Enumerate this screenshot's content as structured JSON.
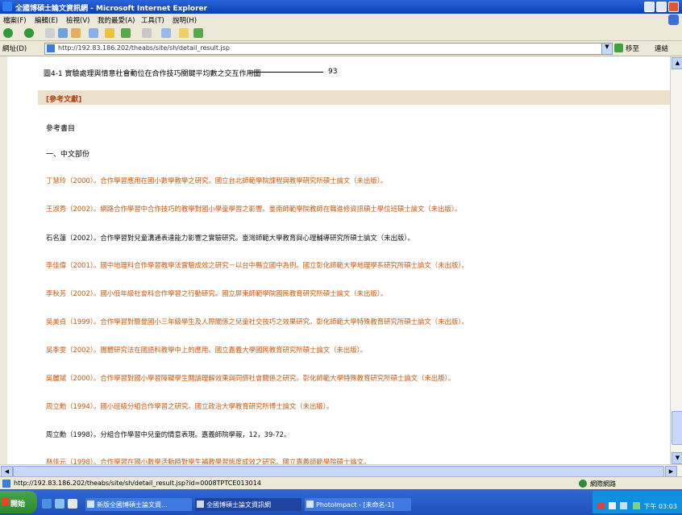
{
  "window": {
    "title": "全國博碩士論文資訊網 - Microsoft Internet Explorer"
  },
  "menu": [
    "檔案(F)",
    "編輯(E)",
    "檢視(V)",
    "我的最愛(A)",
    "工具(T)",
    "說明(H)"
  ],
  "address": {
    "label": "網址(D)",
    "url": "http://192.83.186.202/theabs/site/sh/detail_result.jsp",
    "go_label": "移至",
    "links_label": "連結"
  },
  "page": {
    "figure_caption": "圖4-1 實驗處理與情意社會動位在合作技巧關鍵平均數之交互作用圖",
    "figure_page": "93",
    "references_tab": "[參考文獻]",
    "heading": "參考書目",
    "subheading": "一、中文部份",
    "references": [
      {
        "text": "丁慧玲（2000）。合作學習應用在國小數學教學之研究。國立台北師範學院課程與教學研究所碩士論文（未出版）。",
        "color": "orange"
      },
      {
        "text": "王淑秀（2002）。網路合作學習中合作技巧的教學對國小學童學習之影響。臺南師範學院教師在職進修資訊碩士學位班碩士論文（未出版）。",
        "color": "orange"
      },
      {
        "text": "石名蓮（2002）。合作學習對兒童溝通表達能力影響之實驗研究。臺灣師範大學教育與心理輔導研究所碩士論文（未出版）。",
        "color": "dark"
      },
      {
        "text": "李佳偉（2001）。國中地理科合作學習教學法實驗成效之研究－以台中縣立國中為例。國立彰化師範大學地理學系研究所碩士論文（未出版）。",
        "color": "orange"
      },
      {
        "text": "李秋芳（2002）。國小低年級社會科合作學習之行動研究。國立屏東師範學院國民教育研究所碩士論文（未出版）。",
        "color": "orange"
      },
      {
        "text": "吳美貞（1999）。合作學習對聽覺國小三年級學生及人際關係之兒童社交技巧之效果研究。彰化師範大學特殊教育研究所碩士論文（未出版）。",
        "color": "orange"
      },
      {
        "text": "吳季雯（2002）。團體研究法在國語科教學中上的應用。國立嘉義大學國民教育研究所碩士論文（未出版）。",
        "color": "orange"
      },
      {
        "text": "吳麗斌（2000）。合作學習對國小學習障礙學生閱讀理解效果與同儕社會關係之研究。彰化師範大學特殊教育研究所碩士論文（未出版）。",
        "color": "orange"
      },
      {
        "text": "周立勳（1994）。國小班級分組合作學習之研究。國立政治大學教育研究所博士論文（未出版）。",
        "color": "orange"
      },
      {
        "text": "周立勳（1998）。分組合作學習中兒童的情意表現。嘉義師院學報，12，39-72。",
        "color": "dark"
      },
      {
        "text": "林佳元（1998）。合作學習在國小數學活動時對學生補教學習態度成效之研究。國立嘉義師範學院碩士論文。",
        "color": "orange"
      }
    ]
  },
  "status": {
    "url": "http://192.83.186.202/theabs/site/sh/detail_result.jsp?id=0008TPTCE013014",
    "zone": "網際網路"
  },
  "taskbar": {
    "start_label": "開始",
    "tasks": [
      "新版全國博碩士論文資...",
      "全國博碩士論文資訊網",
      "全國博碩士論文資訊網",
      "PhotoImpact - [未命名-1]"
    ],
    "clock": "下午 03:03"
  },
  "colors": {
    "orange": "#c9570c",
    "band": "#ebe0c9",
    "band_text": "#b5441a"
  }
}
